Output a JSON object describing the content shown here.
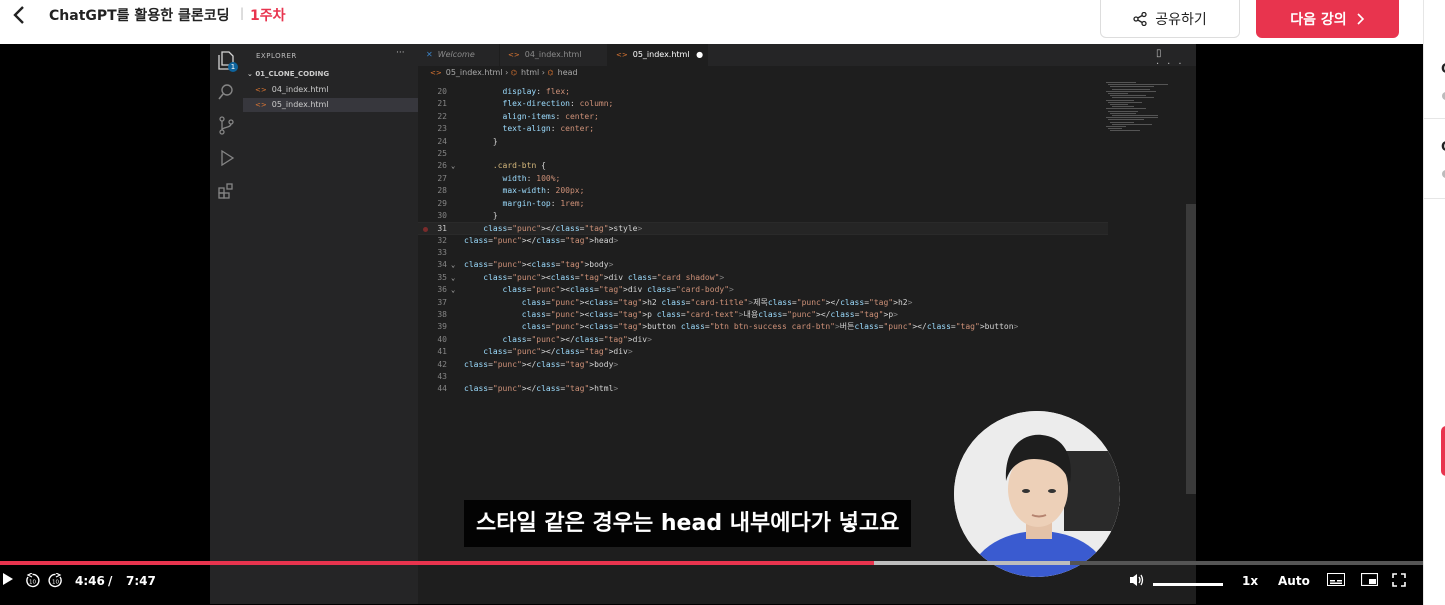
{
  "header": {
    "course_title": "ChatGPT를 활용한 클론코딩",
    "separator": "|",
    "week": "1주차",
    "share_label": "공유하기",
    "next_label": "다음 강의"
  },
  "sidepanel": {
    "letters": [
      "C",
      "C"
    ]
  },
  "vscode": {
    "explorer_title": "EXPLORER",
    "explorer_more": "···",
    "folder": "01_CLONE_CODING",
    "files": [
      "04_index.html",
      "05_index.html"
    ],
    "tabs": [
      {
        "label": "Welcome"
      },
      {
        "label": "04_index.html"
      },
      {
        "label": "05_index.html",
        "dirty": "●"
      }
    ],
    "breadcrumb": [
      "05_index.html",
      "html",
      "head"
    ],
    "lines": [
      {
        "n": "20",
        "code": "        display: flex;"
      },
      {
        "n": "21",
        "code": "        flex-direction: column;"
      },
      {
        "n": "22",
        "code": "        align-items: center;"
      },
      {
        "n": "23",
        "code": "        text-align: center;"
      },
      {
        "n": "24",
        "code": "      }"
      },
      {
        "n": "25",
        "code": ""
      },
      {
        "n": "26",
        "code": "      .card-btn {"
      },
      {
        "n": "27",
        "code": "        width: 100%;"
      },
      {
        "n": "28",
        "code": "        max-width: 200px;"
      },
      {
        "n": "29",
        "code": "        margin-top: 1rem;"
      },
      {
        "n": "30",
        "code": "      }"
      },
      {
        "n": "31",
        "code": "    </style>"
      },
      {
        "n": "32",
        "code": "</head>"
      },
      {
        "n": "33",
        "code": ""
      },
      {
        "n": "34",
        "code": "<body>"
      },
      {
        "n": "35",
        "code": "    <div class=\"card shadow\">"
      },
      {
        "n": "36",
        "code": "        <div class=\"card-body\">"
      },
      {
        "n": "37",
        "code": "            <h2 class=\"card-title\">제목</h2>"
      },
      {
        "n": "38",
        "code": "            <p class=\"card-text\">내용</p>"
      },
      {
        "n": "39",
        "code": "            <button class=\"btn btn-success card-btn\">버튼</button>"
      },
      {
        "n": "40",
        "code": "        </div>"
      },
      {
        "n": "41",
        "code": "    </div>"
      },
      {
        "n": "42",
        "code": "</body>"
      },
      {
        "n": "43",
        "code": ""
      },
      {
        "n": "44",
        "code": "</html>"
      }
    ]
  },
  "subtitle": "스타일 같은 경우는 head 내부에다가 넣고요",
  "player": {
    "current_time": "4:46",
    "time_sep": "/",
    "duration": "7:47",
    "progress_fraction": 0.614,
    "speed": "1x",
    "quality": "Auto"
  },
  "colors": {
    "accent": "#e8344e",
    "editor_bg": "#1e1e1e"
  }
}
